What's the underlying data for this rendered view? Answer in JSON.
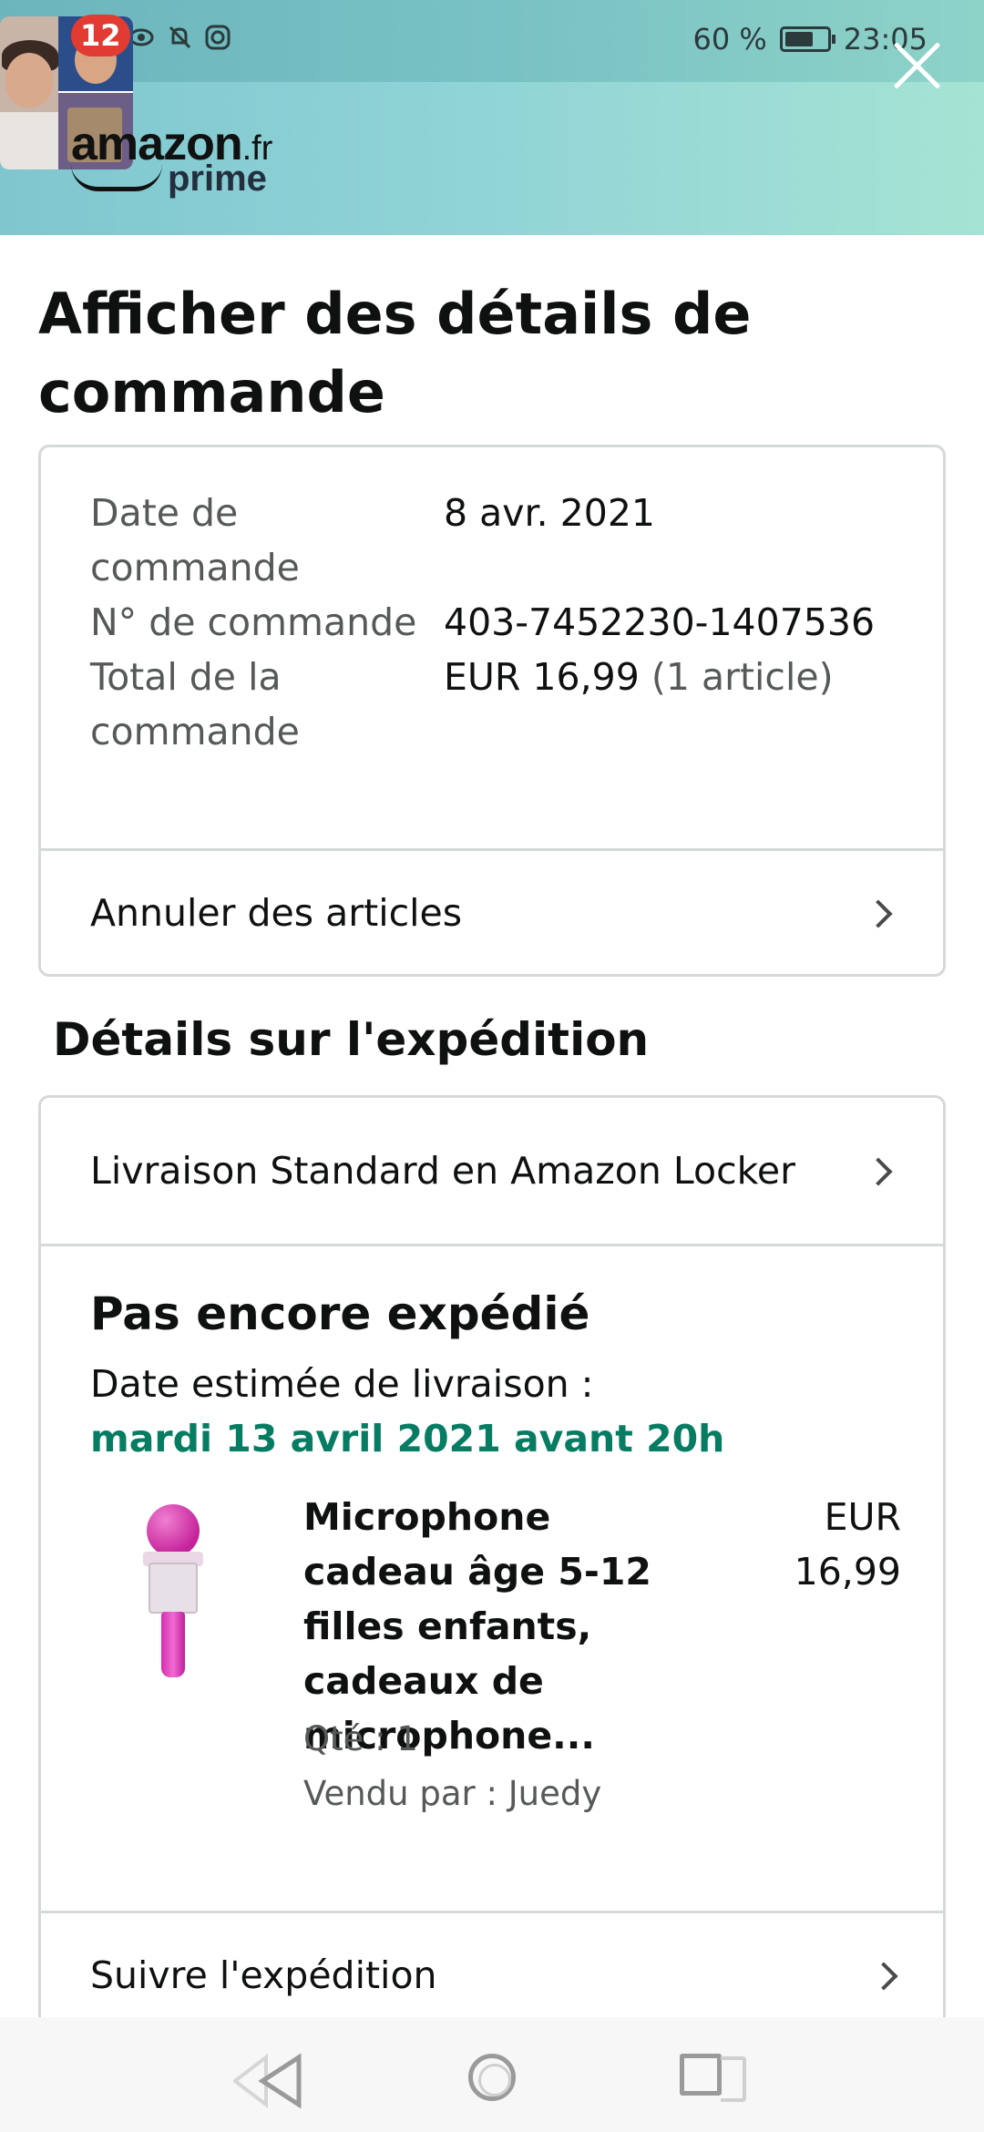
{
  "status_bar": {
    "notification_count": "12",
    "battery": "60 %",
    "time": "23:05",
    "icons": [
      "eye-icon",
      "bell-off-icon",
      "instagram-icon",
      "battery-icon"
    ]
  },
  "header": {
    "logo_word": "amazon",
    "logo_tld": ".fr",
    "logo_prime": "prime",
    "close_icon": "close-icon"
  },
  "page": {
    "title": "Afficher des détails de commande"
  },
  "summary": {
    "rows": [
      {
        "label": "Date de commande",
        "value": "8 avr. 2021"
      },
      {
        "label": "N° de commande",
        "value": "403-7452230-1407536"
      },
      {
        "label": "Total de la commande",
        "value": "EUR 16,99",
        "value_extra": "(1 article)"
      }
    ],
    "cancel_link": "Annuler des articles"
  },
  "shipping": {
    "section_title": "Détails sur l'expédition",
    "method": "Livraison Standard en Amazon Locker",
    "status": "Pas encore expédié",
    "date_label": "Date estimée de livraison :",
    "date_value": "mardi 13 avril 2021 avant 20h",
    "item": {
      "title": "Microphone cadeau âge 5-12 filles enfants, cadeaux de microphone...",
      "price_currency": "EUR",
      "price_value": "16,99",
      "qty": "Qté : 1",
      "seller": "Vendu par : Juedy"
    },
    "track_link": "Suivre l'expédition"
  },
  "colors": {
    "accent_green": "#067d62",
    "header_start": "#7fc6cf",
    "header_end": "#a5e3d4"
  }
}
